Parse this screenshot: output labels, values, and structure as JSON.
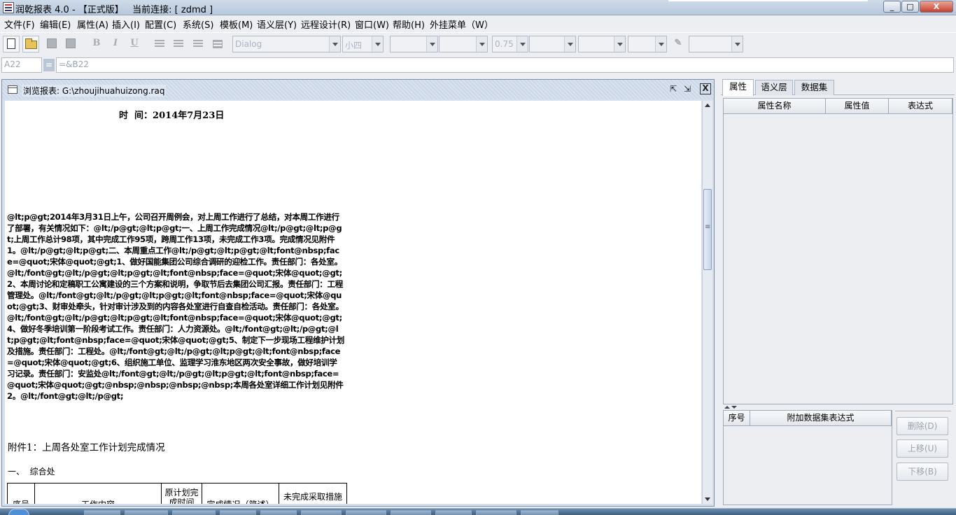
{
  "window": {
    "title": "润乾报表 4.0 - 【正式版】   当前连接: [ zdmd ]",
    "minimize_glyph": "_",
    "maximize_glyph": "□",
    "close_glyph": "X"
  },
  "menu": [
    "文件(F)",
    "编辑(E)",
    "属性(A)",
    "插入(I)",
    "配置(C)",
    "系统(S)",
    "模板(M)",
    "语义层(Y)",
    "远程设计(R)",
    "窗口(W)",
    "帮助(H)",
    "外挂菜单（W）"
  ],
  "toolbar": {
    "bold": "B",
    "italic": "I",
    "underline": "U",
    "font_name": "Dialog",
    "font_size": "小四",
    "border_width": "0.75"
  },
  "formula": {
    "cell_name": "A22",
    "eq": "=",
    "expression": "=&B22"
  },
  "document": {
    "title": "浏览报表: G:\\zhoujihuahuizong.raq",
    "restore_glyph": "⇱",
    "max_glyph": "⇲",
    "close_glyph": "X",
    "time_line": "时  间：2014年7月23日",
    "body_text": "@lt;p@gt;2014年3月31日上午，公司召开周例会，对上周工作进行了总结，对本周工作进行了部署，有关情况如下：@lt;/p@gt;@lt;p@gt;一、上周工作完成情况@lt;/p@gt;@lt;p@gt;上周工作总计98项，其中完成工作95项，跨周工作13项，未完成工作3项。完成情况见附件1。@lt;/p@gt;@lt;p@gt;二、本周重点工作@lt;/p@gt;@lt;p@gt;@lt;font@nbsp;face=@quot;宋体@quot;@gt;1、做好国能集团公司综合调研的迎检工作。责任部门：各处室。@lt;/font@gt;@lt;/p@gt;@lt;p@gt;@lt;font@nbsp;face=@quot;宋体@quot;@gt;2、本周讨论和定稿职工公寓建设的三个方案和说明，争取节后去集团公司汇报。责任部门：工程管理处。@lt;/font@gt;@lt;/p@gt;@lt;p@gt;@lt;font@nbsp;face=@quot;宋体@quot;@gt;3、财审处牵头，针对审计涉及到的内容各处室进行自查自检活动。责任部门：各处室。@lt;/font@gt;@lt;/p@gt;@lt;p@gt;@lt;font@nbsp;face=@quot;宋体@quot;@gt;4、做好冬季培训第一阶段考试工作。责任部门：人力资源处。@lt;/font@gt;@lt;/p@gt;@lt;p@gt;@lt;font@nbsp;face=@quot;宋体@quot;@gt;5、制定下一步现场工程维护计划及措施。责任部门：工程处。@lt;/font@gt;@lt;/p@gt;@lt;p@gt;@lt;font@nbsp;face=@quot;宋体@quot;@gt;6、组织施工单位、监理学习淮东地区两次安全事故，做好培训学习记录。责任部门：安监处@lt;/font@gt;@lt;/p@gt;@lt;p@gt;@lt;font@nbsp;face=@quot;宋体@quot;@gt;@nbsp;@nbsp;@nbsp;@nbsp;本周各处室详细工作计划见附件2。@lt;/font@gt;@lt;/p@gt;",
    "attachment_title": "附件1：上周各处室工作计划完成情况",
    "section_title": "一、  综合处",
    "table_headers": [
      "序号",
      "工作内容",
      "原计划完成时间",
      "完成情况（简述）",
      "未完成采取措施"
    ]
  },
  "right_panel": {
    "tabs": [
      "属性",
      "语义层",
      "数据集"
    ],
    "prop_headers": [
      "属性名称",
      "属性值",
      "表达式"
    ],
    "ds_headers": [
      "序号",
      "附加数据集表达式"
    ],
    "buttons": [
      "删除(D)",
      "上移(U)",
      "下移(B)"
    ]
  }
}
